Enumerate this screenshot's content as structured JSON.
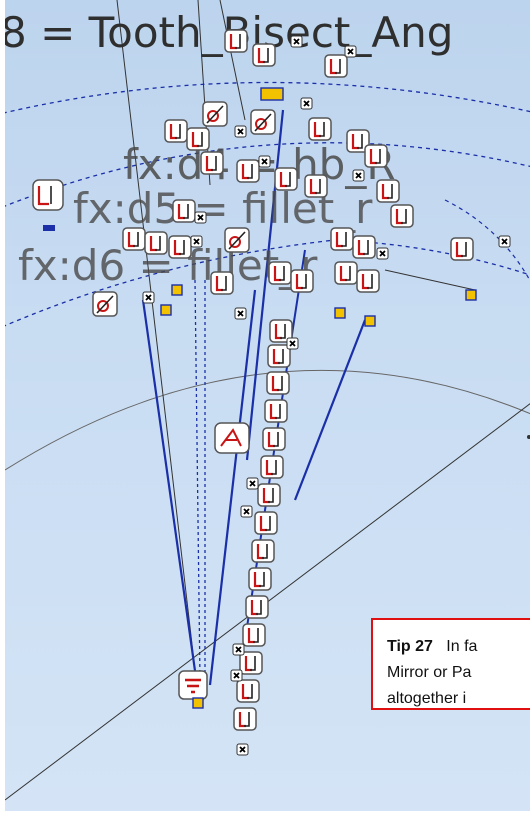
{
  "canvas": {
    "equations": [
      "8 = Tooth_Bisect_Ang",
      "fx:d4 = hb_R",
      "fx:d5 = fillet_r",
      "fx:d6 = fillet_r"
    ]
  },
  "constraint_icons": {
    "coincident_label": "coincident-constraint-icon",
    "tangent_label": "tangent-constraint-icon",
    "parallel_label": "parallel-constraint-icon",
    "equal_label": "equal-constraint-icon",
    "fix_label": "fix-constraint-icon",
    "close_label": "close-icon"
  },
  "tip": {
    "title": "Tip 27",
    "line1": "In fa",
    "line2": "Mirror or Pa",
    "line3": "altogether i"
  },
  "colors": {
    "background": "#c8dcf2",
    "construction_line": "#1a2fa8",
    "constraint_red": "#c81414",
    "tip_border": "#e01010",
    "fixed_point": "#f2c200"
  }
}
